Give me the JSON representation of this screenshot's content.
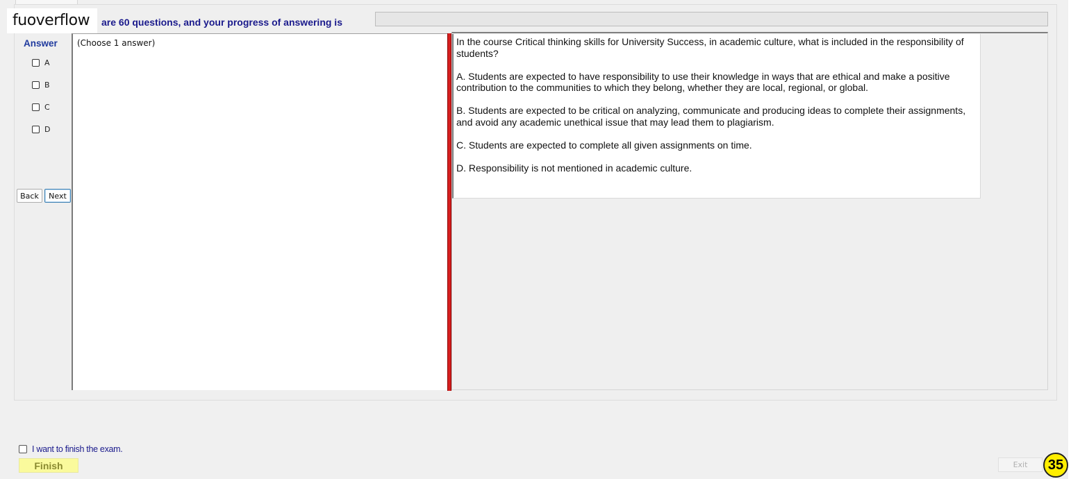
{
  "watermark": "fuoverflow",
  "header": {
    "progress_text": "are 60 questions, and your progress of answering is",
    "progress_fraction": 0
  },
  "answer_panel": {
    "heading": "Answer",
    "instruction": "(Choose 1 answer)",
    "options": [
      {
        "label": "A",
        "checked": false
      },
      {
        "label": "B",
        "checked": false
      },
      {
        "label": "C",
        "checked": false
      },
      {
        "label": "D",
        "checked": false
      }
    ],
    "back_label": "Back",
    "next_label": "Next"
  },
  "question": {
    "stem": "In the course Critical thinking skills for University Success, in academic culture, what is included in the responsibility of students?",
    "choices": [
      "A.  Students are expected to have responsibility to use their knowledge in ways that are ethical and make a positive contribution to the communities to which they belong, whether they are local, regional, or global.",
      "B.  Students are expected to be critical on analyzing, communicate and producing ideas to complete their assignments, and avoid any academic unethical issue that may lead them to plagiarism.",
      "C.  Students are expected to complete all given assignments on time.",
      "D.  Responsibility is not mentioned in academic culture."
    ]
  },
  "footer": {
    "finish_checkbox_label": "I want to finish the exam.",
    "finish_label": "Finish",
    "exit_label": "Exit",
    "question_number": "35"
  },
  "colors": {
    "accent_text": "#1a1a8c",
    "splitter": "#d61f1f",
    "finish_bg": "#fafa9c",
    "badge_bg": "#ffee00"
  }
}
